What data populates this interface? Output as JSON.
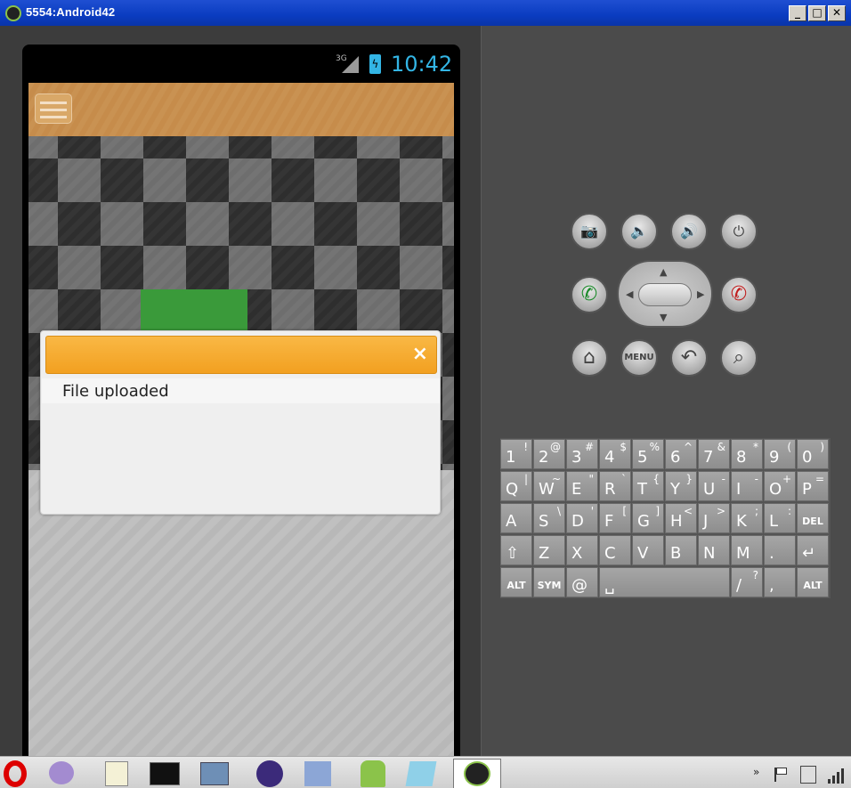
{
  "window": {
    "title": "5554:Android42",
    "minimize_label": "_",
    "maximize_label": "□",
    "close_label": "✕"
  },
  "status_bar": {
    "network": "3G",
    "battery_glyph": "ϟ",
    "time": "10:42"
  },
  "dialog": {
    "close_glyph": "×",
    "message": "File uploaded"
  },
  "controls": {
    "camera": "📷",
    "vol_down": "🔈",
    "vol_up": "🔊",
    "power": "⏻",
    "call": "✆",
    "end_call": "✆",
    "home": "⌂",
    "menu": "MENU",
    "back": "↶",
    "search": "⌕",
    "dpad_up": "▲",
    "dpad_down": "▼",
    "dpad_left": "◀",
    "dpad_right": "▶"
  },
  "keyboard": {
    "rows": [
      [
        [
          "1",
          "!"
        ],
        [
          "2",
          "@"
        ],
        [
          "3",
          "#"
        ],
        [
          "4",
          "$"
        ],
        [
          "5",
          "%"
        ],
        [
          "6",
          "^"
        ],
        [
          "7",
          "&"
        ],
        [
          "8",
          "*"
        ],
        [
          "9",
          "("
        ],
        [
          "0",
          ")"
        ]
      ],
      [
        [
          "Q",
          "|"
        ],
        [
          "W",
          "~"
        ],
        [
          "E",
          "\""
        ],
        [
          "R",
          "`"
        ],
        [
          "T",
          "{"
        ],
        [
          "Y",
          "}"
        ],
        [
          "U",
          "-"
        ],
        [
          "I",
          "-"
        ],
        [
          "O",
          "+"
        ],
        [
          "P",
          "="
        ]
      ],
      [
        [
          "A",
          ""
        ],
        [
          "S",
          "\\"
        ],
        [
          "D",
          "'"
        ],
        [
          "F",
          "["
        ],
        [
          "G",
          "]"
        ],
        [
          "H",
          "<"
        ],
        [
          "J",
          ">"
        ],
        [
          "K",
          ";"
        ],
        [
          "L",
          ":"
        ],
        [
          "DEL",
          ""
        ]
      ],
      [
        [
          "⇧",
          ""
        ],
        [
          "Z",
          ""
        ],
        [
          "X",
          ""
        ],
        [
          "C",
          ""
        ],
        [
          "V",
          ""
        ],
        [
          "B",
          ""
        ],
        [
          "N",
          ""
        ],
        [
          "M",
          ""
        ],
        [
          ".",
          ""
        ],
        [
          "↵",
          ""
        ]
      ],
      [
        [
          "ALT",
          ""
        ],
        [
          "SYM",
          ""
        ],
        [
          "@",
          ""
        ],
        [
          "␣",
          ""
        ],
        [
          "/",
          "?"
        ],
        [
          ",",
          ""
        ],
        [
          "ALT",
          ""
        ]
      ]
    ]
  },
  "taskbar": {
    "tray_chevron": "»"
  }
}
